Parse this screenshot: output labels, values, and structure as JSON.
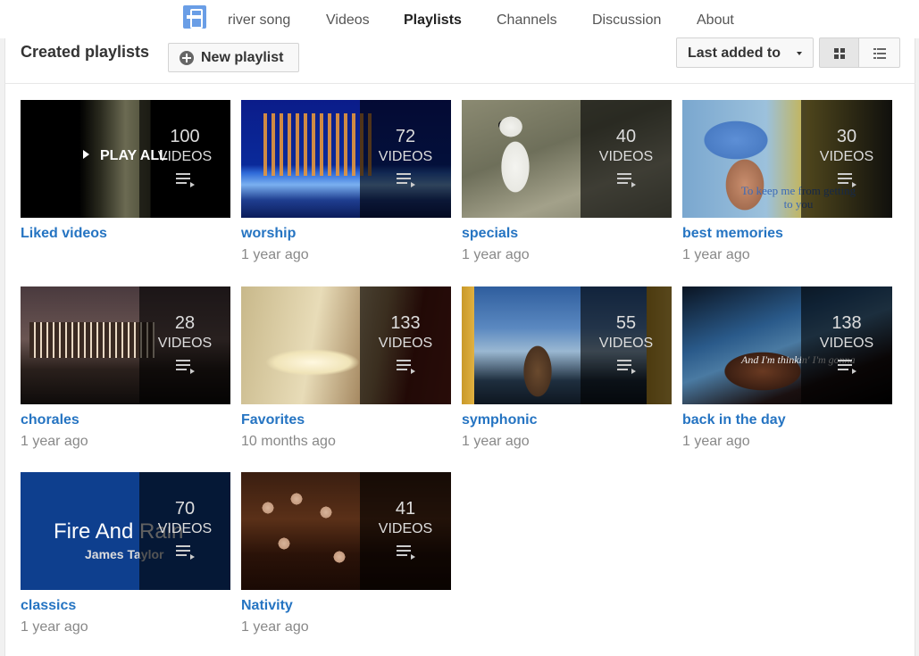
{
  "nav": {
    "channel": "river song",
    "items": [
      "Videos",
      "Playlists",
      "Channels",
      "Discussion",
      "About"
    ],
    "active": "Playlists"
  },
  "toolbar": {
    "section_title": "Created playlists",
    "new_playlist_label": "New playlist",
    "sort_label": "Last added to",
    "view_grid_icon": "grid-view-icon",
    "view_list_icon": "list-view-icon"
  },
  "playlists": [
    {
      "title": "Liked videos",
      "count": "100",
      "count_label": "VIDEOS",
      "meta": "",
      "play_all": "PLAY ALL"
    },
    {
      "title": "worship",
      "count": "72",
      "count_label": "VIDEOS",
      "meta": "1 year ago"
    },
    {
      "title": "specials",
      "count": "40",
      "count_label": "VIDEOS",
      "meta": "1 year ago"
    },
    {
      "title": "best memories",
      "count": "30",
      "count_label": "VIDEOS",
      "meta": "1 year ago",
      "overlay": "To keep me from getting\nto you"
    },
    {
      "title": "chorales",
      "count": "28",
      "count_label": "VIDEOS",
      "meta": "1 year ago"
    },
    {
      "title": "Favorites",
      "count": "133",
      "count_label": "VIDEOS",
      "meta": "10 months ago"
    },
    {
      "title": "symphonic",
      "count": "55",
      "count_label": "VIDEOS",
      "meta": "1 year ago"
    },
    {
      "title": "back in the day",
      "count": "138",
      "count_label": "VIDEOS",
      "meta": "1 year ago",
      "overlay": "And I'm thinkin' I'm gonna"
    },
    {
      "title": "classics",
      "count": "70",
      "count_label": "VIDEOS",
      "meta": "1 year ago",
      "overlay_title": "Fire And Rain",
      "overlay_sub": "James Taylor"
    },
    {
      "title": "Nativity",
      "count": "41",
      "count_label": "VIDEOS",
      "meta": "1 year ago"
    }
  ],
  "colors": {
    "link": "#2574c2",
    "meta": "#888888",
    "accent": "#6a9ee6"
  }
}
